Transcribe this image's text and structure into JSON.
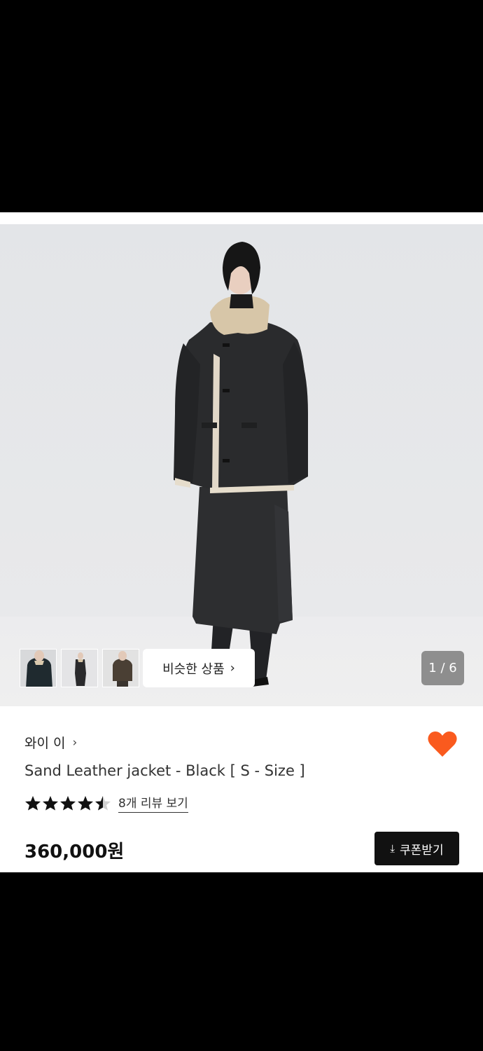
{
  "gallery": {
    "thumbnail_names": [
      "thumb-front",
      "thumb-full",
      "thumb-brown"
    ],
    "similar_label": "비슷한 상품",
    "page_indicator": "1 / 6"
  },
  "product": {
    "brand": "와이 이",
    "title": "Sand Leather jacket - Black [ S - Size ]",
    "rating": 4.5,
    "review_link": "8개 리뷰 보기",
    "price": "360,000원",
    "coupon_label": "쿠폰받기",
    "wishlisted": true
  },
  "colors": {
    "heart": "#fa5a1e",
    "coupon_bg": "#111111",
    "star": "#111111"
  }
}
